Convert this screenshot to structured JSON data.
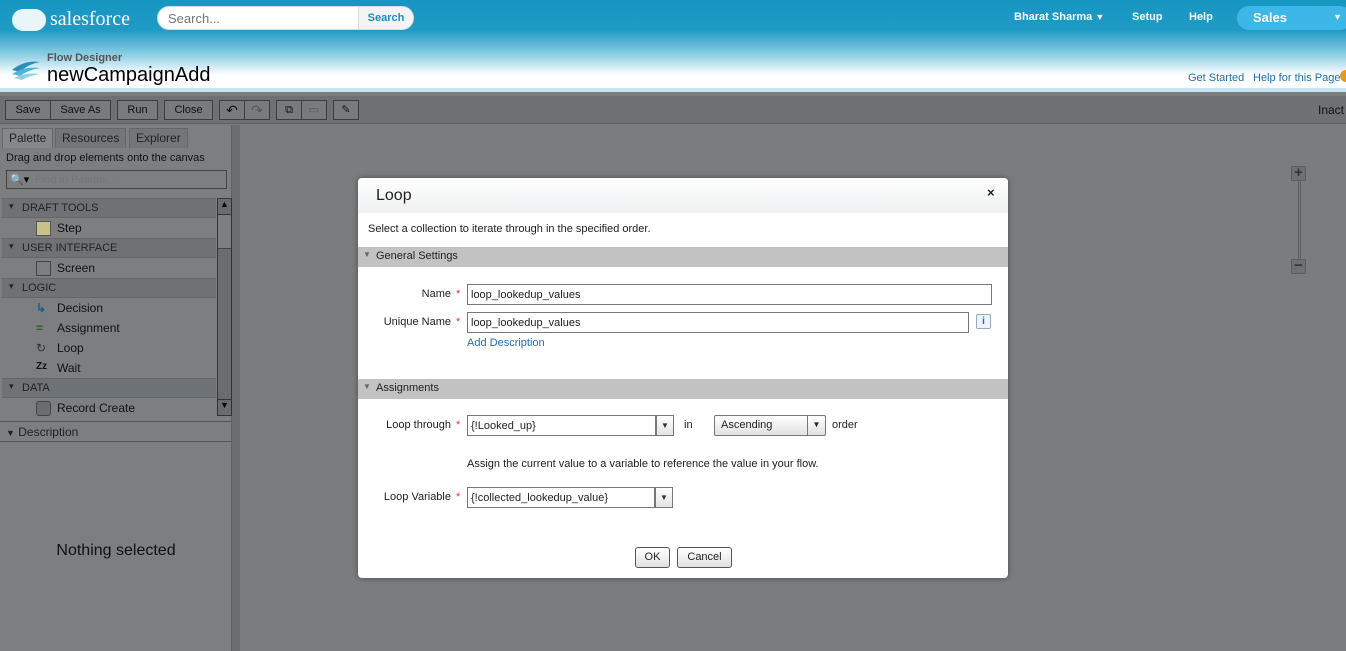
{
  "header": {
    "brand": "salesforce",
    "search_placeholder": "Search...",
    "search_button": "Search",
    "user": "Bharat Sharma",
    "setup": "Setup",
    "help": "Help",
    "app": "Sales",
    "app_label": "Flow Designer",
    "flow_name": "newCampaignAdd",
    "get_started": "Get Started",
    "help_page": "Help for this Page"
  },
  "toolbar": {
    "save": "Save",
    "save_as": "Save As",
    "run": "Run",
    "close": "Close",
    "status": "Inact"
  },
  "sidebar": {
    "tabs": [
      "Palette",
      "Resources",
      "Explorer"
    ],
    "hint": "Drag and drop elements onto the canvas",
    "find_placeholder": "Find in Palette...",
    "sections": [
      {
        "label": "DRAFT TOOLS",
        "items": [
          "Step"
        ]
      },
      {
        "label": "USER INTERFACE",
        "items": [
          "Screen"
        ]
      },
      {
        "label": "LOGIC",
        "items": [
          "Decision",
          "Assignment",
          "Loop",
          "Wait"
        ]
      },
      {
        "label": "DATA",
        "items": [
          "Record Create"
        ]
      }
    ],
    "description_label": "Description",
    "nothing_selected": "Nothing selected"
  },
  "dialog": {
    "title": "Loop",
    "close": "×",
    "description": "Select a collection to iterate through in the specified order.",
    "general_settings": "General Settings",
    "name_label": "Name",
    "name_value": "loop_lookedup_values",
    "unique_name_label": "Unique Name",
    "unique_name_value": "loop_lookedup_values",
    "add_description": "Add Description",
    "assignments": "Assignments",
    "loop_through_label": "Loop through",
    "loop_through_value": "{!Looked_up}",
    "in": "in",
    "order_value": "Ascending",
    "order": "order",
    "assign_hint": "Assign the current value to a variable to reference the value in your flow.",
    "loop_variable_label": "Loop Variable",
    "loop_variable_value": "{!collected_lookedup_value}",
    "ok": "OK",
    "cancel": "Cancel",
    "required": "*"
  }
}
